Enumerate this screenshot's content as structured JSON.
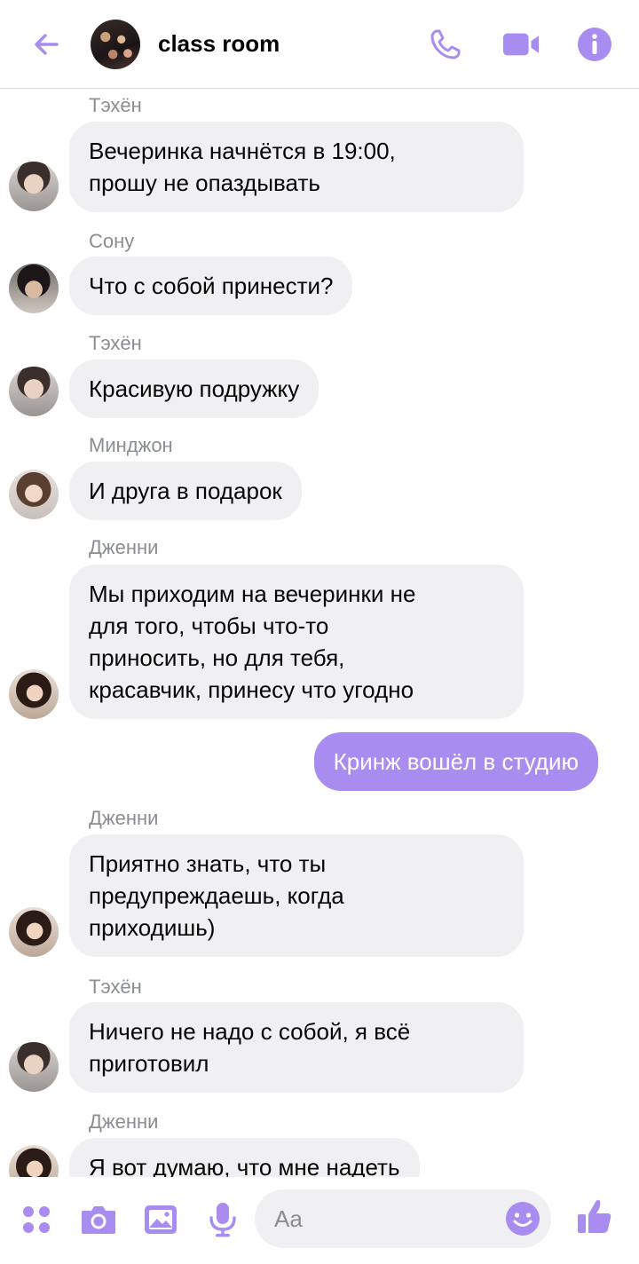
{
  "header": {
    "title": "class room",
    "back_icon": "arrow-left-icon",
    "call_icon": "phone-icon",
    "video_icon": "video-camera-icon",
    "info_icon": "info-icon"
  },
  "accent_color": "#a88cf0",
  "messages": [
    {
      "sender": "Тэхён",
      "lines": [
        "Вечеринка начнётся в 19:00,",
        "прошу не опаздывать"
      ]
    },
    {
      "sender": "Сону",
      "lines": [
        "Что с собой принести?"
      ]
    },
    {
      "sender": "Тэхён",
      "lines": [
        "Красивую подружку"
      ]
    },
    {
      "sender": "Минджон",
      "lines": [
        "И друга в подарок"
      ]
    },
    {
      "sender": "Дженни",
      "lines": [
        "Мы приходим на вечеринки не",
        "для того, чтобы что-то",
        "приносить, но для тебя,",
        "красавчик, принесу что угодно"
      ]
    },
    {
      "outgoing": true,
      "lines": [
        "Кринж вошёл в студию"
      ]
    },
    {
      "sender": "Дженни",
      "lines": [
        "Приятно знать, что ты",
        "предупреждаешь, когда",
        "приходишь)"
      ]
    },
    {
      "sender": "Тэхён",
      "lines": [
        "Ничего не надо с собой, я всё",
        "приготовил"
      ]
    },
    {
      "sender": "Дженни",
      "lines": [
        "Я вот думаю, что мне надеть"
      ]
    }
  ],
  "composer": {
    "placeholder": "Aa",
    "icons": [
      "menu-dots-icon",
      "camera-icon",
      "image-icon",
      "microphone-icon",
      "emoji-icon",
      "thumbs-up-icon"
    ]
  }
}
